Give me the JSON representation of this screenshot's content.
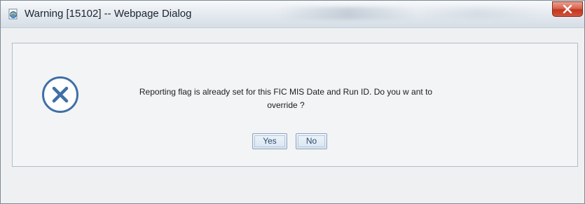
{
  "window": {
    "title": "Warning [15102] -- Webpage Dialog"
  },
  "dialog": {
    "message": "Reporting flag is already set for this FIC MIS Date and Run ID. Do you w ant to override ?",
    "buttons": {
      "yes_label": "Yes",
      "no_label": "No"
    }
  },
  "icons": {
    "app": "ie-page-icon",
    "close": "close-icon",
    "status": "error-x-icon"
  },
  "colors": {
    "close_button": "#c2371f",
    "error_icon": "#3f6fa8",
    "button_text": "#2d4a6b"
  }
}
